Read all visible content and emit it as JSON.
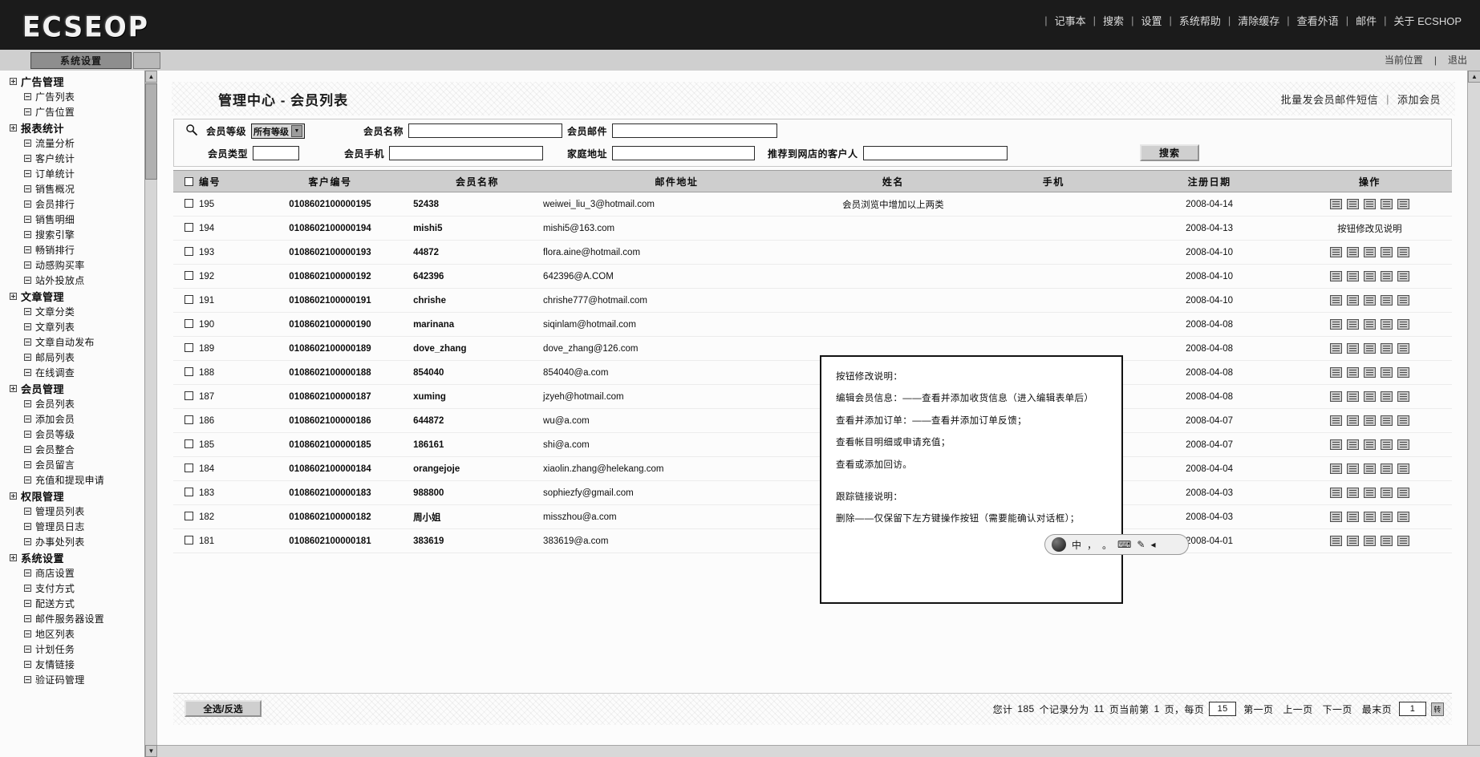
{
  "app": {
    "logo": "ECSEOP",
    "topnav": [
      "记事本",
      "搜索",
      "设置",
      "系统帮助",
      "清除缓存",
      "查看外语",
      "邮件",
      "关于 ECSHOP"
    ],
    "subbar": {
      "tab": "系统设置",
      "right_links": [
        "当前位置",
        "退出"
      ]
    }
  },
  "sidebar": {
    "groups": [
      {
        "title": "广告管理",
        "items": [
          "广告列表",
          "广告位置"
        ]
      },
      {
        "title": "报表统计",
        "items": [
          "流量分析",
          "客户统计",
          "订单统计",
          "销售概况",
          "会员排行",
          "销售明细",
          "搜索引擎",
          "畅销排行",
          "动感购买率",
          "站外投放点"
        ]
      },
      {
        "title": "文章管理",
        "items": [
          "文章分类",
          "文章列表",
          "文章自动发布",
          "邮局列表",
          "在线调查"
        ]
      },
      {
        "title": "会员管理",
        "items": [
          "会员列表",
          "添加会员",
          "会员等级",
          "会员整合",
          "会员留言",
          "充值和提现申请"
        ]
      },
      {
        "title": "权限管理",
        "items": [
          "管理员列表",
          "管理员日志",
          "办事处列表"
        ]
      },
      {
        "title": "系统设置",
        "items": [
          "商店设置",
          "支付方式",
          "配送方式",
          "邮件服务器设置",
          "地区列表",
          "计划任务",
          "友情链接",
          "验证码管理"
        ]
      }
    ]
  },
  "page": {
    "title": "管理中心 - 会员列表",
    "head_right": [
      "批量发会员邮件短信",
      "添加会员"
    ]
  },
  "search": {
    "level_label": "会员等级",
    "level_value": "所有等级",
    "name_label": "会员名称",
    "name_value": "",
    "mail_label": "会员邮件",
    "mail_value": "",
    "type_label": "会员类型",
    "type_value": "",
    "mobile_label": "会员手机",
    "mobile_value": "",
    "address_label": "家庭地址",
    "address_value": "",
    "referrer_label": "推荐到网店的客户人",
    "referrer_value": "",
    "button": "搜索"
  },
  "table": {
    "headers": [
      "编号",
      "客户编号",
      "会员名称",
      "邮件地址",
      "姓名",
      "手机",
      "注册日期",
      "操作"
    ],
    "rows": [
      {
        "id": "195",
        "cust": "0108602100000195",
        "name": "52438",
        "mail": "weiwei_liu_3@hotmail.com",
        "real": "会员浏览中增加以上两类",
        "mob": "",
        "date": "2008-04-14",
        "ops": "icons"
      },
      {
        "id": "194",
        "cust": "0108602100000194",
        "name": "mishi5",
        "mail": "mishi5@163.com",
        "real": "",
        "mob": "",
        "date": "2008-04-13",
        "ops": "按钮修改见说明"
      },
      {
        "id": "193",
        "cust": "0108602100000193",
        "name": "44872",
        "mail": "flora.aine@hotmail.com",
        "real": "",
        "mob": "",
        "date": "2008-04-10",
        "ops": "icons"
      },
      {
        "id": "192",
        "cust": "0108602100000192",
        "name": "642396",
        "mail": "642396@A.COM",
        "real": "",
        "mob": "",
        "date": "2008-04-10",
        "ops": "icons"
      },
      {
        "id": "191",
        "cust": "0108602100000191",
        "name": "chrishe",
        "mail": "chrishe777@hotmail.com",
        "real": "",
        "mob": "",
        "date": "2008-04-10",
        "ops": "icons"
      },
      {
        "id": "190",
        "cust": "0108602100000190",
        "name": "marinana",
        "mail": "siqinlam@hotmail.com",
        "real": "",
        "mob": "",
        "date": "2008-04-08",
        "ops": "icons"
      },
      {
        "id": "189",
        "cust": "0108602100000189",
        "name": "dove_zhang",
        "mail": "dove_zhang@126.com",
        "real": "",
        "mob": "",
        "date": "2008-04-08",
        "ops": "icons"
      },
      {
        "id": "188",
        "cust": "0108602100000188",
        "name": "854040",
        "mail": "854040@a.com",
        "real": "",
        "mob": "",
        "date": "2008-04-08",
        "ops": "icons"
      },
      {
        "id": "187",
        "cust": "0108602100000187",
        "name": "xuming",
        "mail": "jzyeh@hotmail.com",
        "real": "",
        "mob": "",
        "date": "2008-04-08",
        "ops": "icons"
      },
      {
        "id": "186",
        "cust": "0108602100000186",
        "name": "644872",
        "mail": "wu@a.com",
        "real": "",
        "mob": "",
        "date": "2008-04-07",
        "ops": "icons"
      },
      {
        "id": "185",
        "cust": "0108602100000185",
        "name": "186161",
        "mail": "shi@a.com",
        "real": "",
        "mob": "",
        "date": "2008-04-07",
        "ops": "icons"
      },
      {
        "id": "184",
        "cust": "0108602100000184",
        "name": "orangejoje",
        "mail": "xiaolin.zhang@helekang.com",
        "real": "",
        "mob": "",
        "date": "2008-04-04",
        "ops": "icons"
      },
      {
        "id": "183",
        "cust": "0108602100000183",
        "name": "988800",
        "mail": "sophiezfy@gmail.com",
        "real": "",
        "mob": "",
        "date": "2008-04-03",
        "ops": "icons"
      },
      {
        "id": "182",
        "cust": "0108602100000182",
        "name": "周小姐",
        "mail": "misszhou@a.com",
        "real": "",
        "mob": "",
        "date": "2008-04-03",
        "ops": "icons"
      },
      {
        "id": "181",
        "cust": "0108602100000181",
        "name": "383619",
        "mail": "383619@a.com",
        "real": "",
        "mob": "",
        "date": "2008-04-01",
        "ops": "icons"
      }
    ]
  },
  "callout": {
    "lines": [
      "按钮修改说明：",
      "编辑会员信息：——查看并添加收货信息（进入编辑表单后）",
      "查看并添加订单：——查看并添加订单反馈；",
      "查看帐目明细或申请充值；",
      "查看或添加回访。",
      "跟踪链接说明：",
      "删除——仅保留下左方键操作按钮（需要能确认对话框）；"
    ]
  },
  "footer": {
    "select_all": "全选/反选",
    "summary_prefix": "您计",
    "total": "185",
    "summary_mid": "个记录分为",
    "pages": "11",
    "summary_cur": "页当前第",
    "current_page": "1",
    "summary_per": "页，每页",
    "per_page": "15",
    "first": "第一页",
    "prev": "上一页",
    "next": "下一页",
    "last": "最末页",
    "goto_value": "1",
    "goto_btn": "转"
  },
  "ime": {
    "items": [
      "中",
      "，",
      "。",
      "⌨",
      "✎",
      "◂"
    ]
  }
}
